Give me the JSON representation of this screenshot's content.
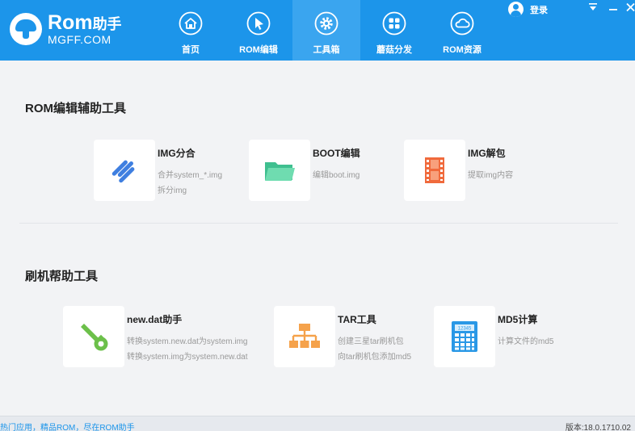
{
  "brand": {
    "title": "Rom",
    "title_suffix": "助手",
    "subtitle": "MGFF.COM"
  },
  "nav": {
    "items": [
      {
        "label": "首页",
        "icon": "home-icon"
      },
      {
        "label": "ROM编辑",
        "icon": "cursor-icon"
      },
      {
        "label": "工具箱",
        "icon": "gear-icon",
        "active": true
      },
      {
        "label": "蘑菇分发",
        "icon": "apps-grid-icon"
      },
      {
        "label": "ROM资源",
        "icon": "cloud-icon"
      }
    ]
  },
  "header": {
    "login_label": "登录"
  },
  "colors": {
    "brand_blue": "#1c95ea",
    "active_tab": "#3aa5ef",
    "link_blue": "#1c95ea"
  },
  "sections": [
    {
      "title": "ROM编辑辅助工具",
      "tools": [
        {
          "name": "IMG分合",
          "desc1": "合并system_*.img",
          "desc2": "拆分img",
          "icon": "link-icon"
        },
        {
          "name": "BOOT编辑",
          "desc1": "编辑boot.img",
          "desc2": "",
          "icon": "folder-icon"
        },
        {
          "name": "IMG解包",
          "desc1": "提取img内容",
          "desc2": "",
          "icon": "film-icon"
        }
      ]
    },
    {
      "title": "刷机帮助工具",
      "tools": [
        {
          "name": "new.dat助手",
          "desc1": "转换system.new.dat为system.img",
          "desc2": "转换system.img为system.new.dat",
          "icon": "wrench-icon"
        },
        {
          "name": "TAR工具",
          "desc1": "创建三星tar刷机包",
          "desc2": "向tar刷机包添加md5",
          "icon": "hierarchy-icon"
        },
        {
          "name": "MD5计算",
          "desc1": "计算文件的md5",
          "desc2": "",
          "icon": "calculator-icon"
        }
      ]
    }
  ],
  "calculator_display": "12345",
  "footer": {
    "tagline": "热门应用，精品ROM，尽在ROM助手",
    "version": "版本:18.0.1710.02"
  }
}
